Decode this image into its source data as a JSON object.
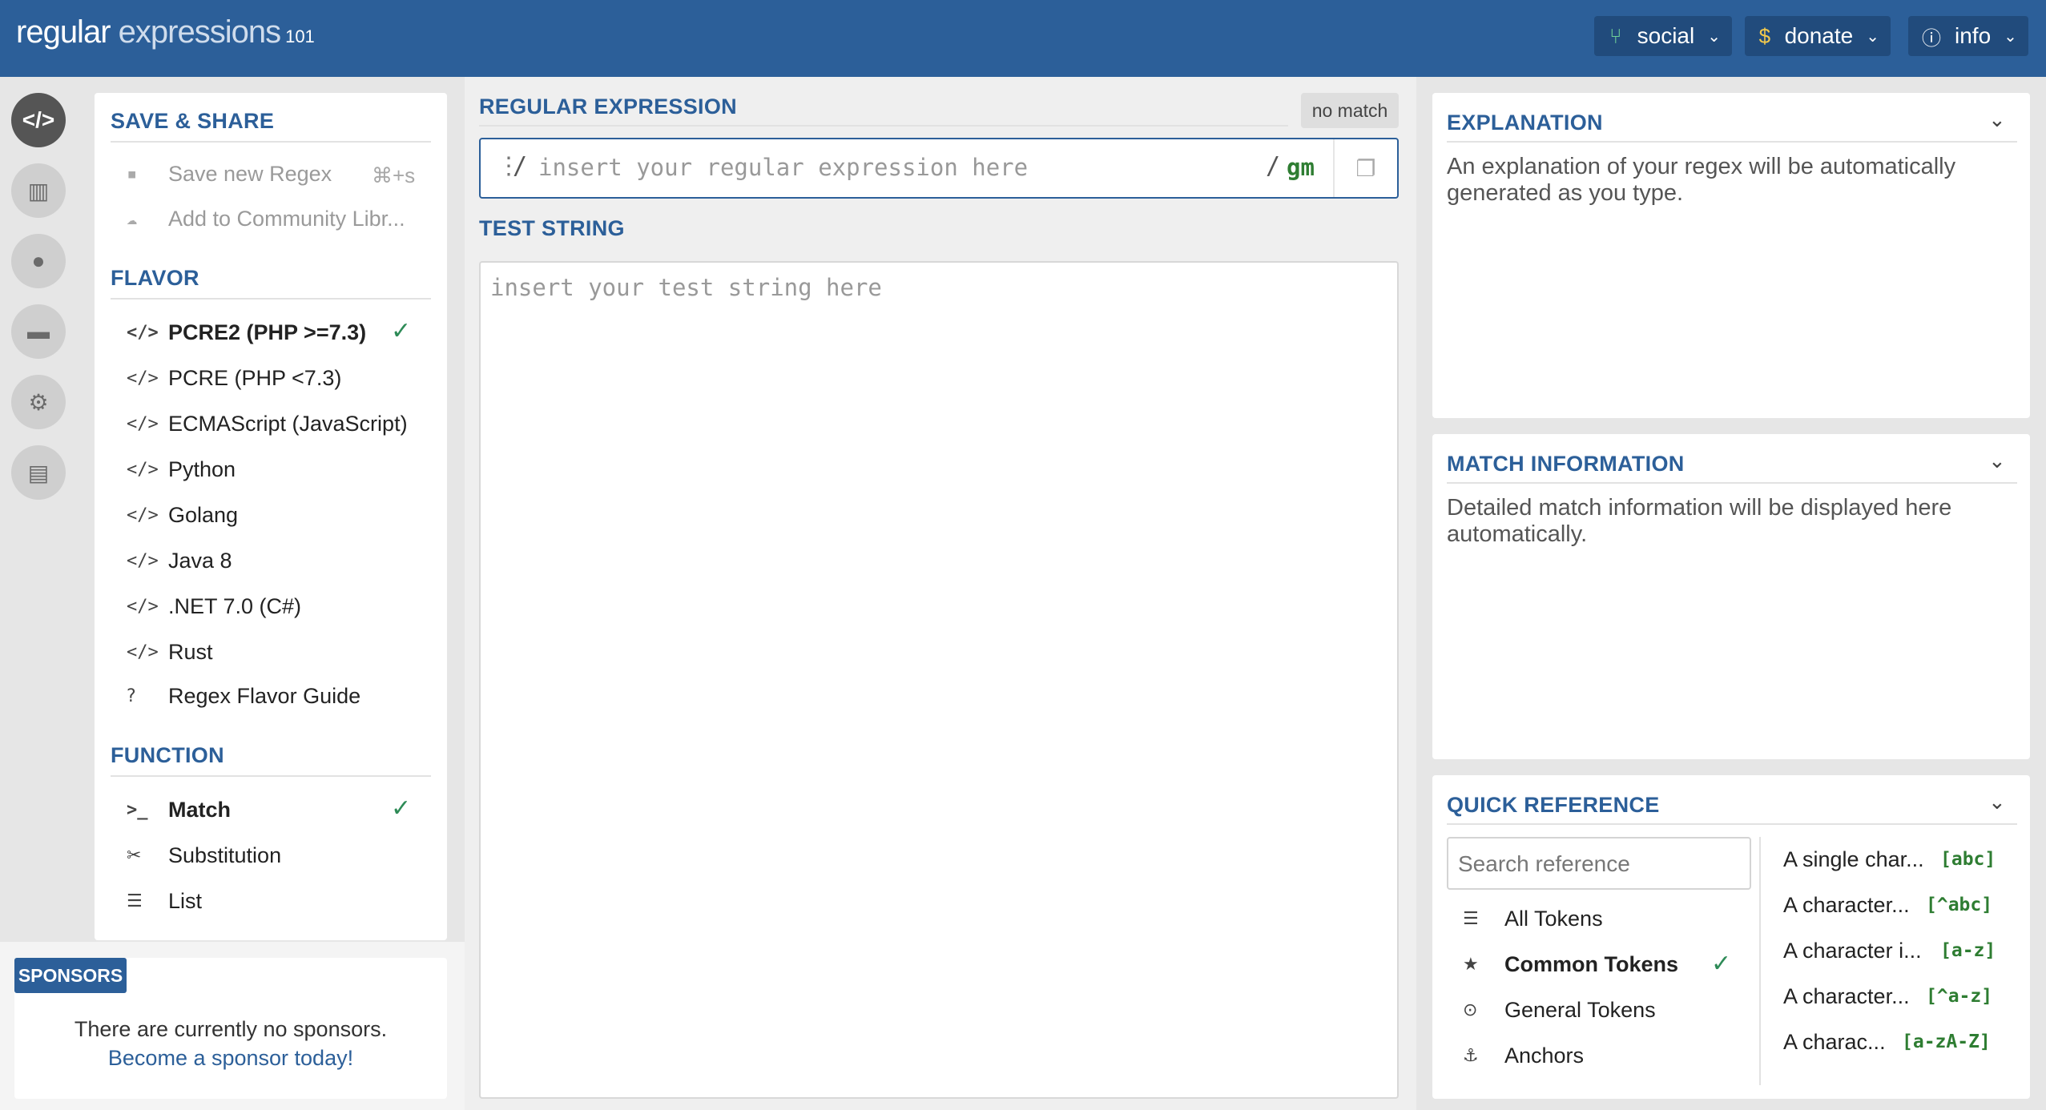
{
  "header": {
    "logo_main": "regular",
    "logo_light": " expressions",
    "logo_num": "101",
    "buttons": [
      {
        "label": "social",
        "icon": "branch-icon"
      },
      {
        "label": "donate",
        "icon": "dollar-icon"
      },
      {
        "label": "info",
        "icon": "info-icon"
      }
    ],
    "accent": "#2c5f99"
  },
  "left": {
    "save_share": {
      "title": "SAVE & SHARE",
      "items": [
        {
          "label": "Save new Regex",
          "shortcut": "⌘+s"
        },
        {
          "label": "Add to Community Libr..."
        }
      ]
    },
    "flavor": {
      "title": "FLAVOR",
      "items": [
        {
          "label": "PCRE2 (PHP >=7.3)",
          "selected": true
        },
        {
          "label": "PCRE (PHP <7.3)"
        },
        {
          "label": "ECMAScript (JavaScript)"
        },
        {
          "label": "Python"
        },
        {
          "label": "Golang"
        },
        {
          "label": "Java 8"
        },
        {
          "label": ".NET 7.0 (C#)"
        },
        {
          "label": "Rust"
        },
        {
          "label": "Regex Flavor Guide"
        }
      ]
    },
    "function": {
      "title": "FUNCTION",
      "items": [
        {
          "label": "Match",
          "selected": true
        },
        {
          "label": "Substitution"
        },
        {
          "label": "List"
        }
      ]
    },
    "sponsors": {
      "tag": "SPONSORS",
      "text": "There are currently no sponsors.",
      "link": "Become a sponsor today!"
    }
  },
  "center": {
    "regex_title": "REGULAR EXPRESSION",
    "status": "no match",
    "regex_open": "/",
    "regex_placeholder": "insert your regular expression here",
    "regex_close": "/",
    "flags": "gm",
    "test_title": "TEST STRING",
    "test_placeholder": "insert your test string here"
  },
  "right": {
    "explanation": {
      "title": "EXPLANATION",
      "text": "An explanation of your regex will be automatically generated as you type."
    },
    "match_info": {
      "title": "MATCH INFORMATION",
      "text": "Detailed match information will be displayed here automatically."
    },
    "quick_ref": {
      "title": "QUICK REFERENCE",
      "search_placeholder": "Search reference",
      "categories": [
        {
          "label": "All Tokens",
          "icon": "stack-icon"
        },
        {
          "label": "Common Tokens",
          "icon": "star-icon",
          "selected": true
        },
        {
          "label": "General Tokens",
          "icon": "target-icon"
        },
        {
          "label": "Anchors",
          "icon": "anchor-icon"
        }
      ],
      "tokens": [
        {
          "desc": "A single char...",
          "code": "[abc]"
        },
        {
          "desc": "A character...",
          "code": "[^abc]"
        },
        {
          "desc": "A character i...",
          "code": "[a-z]"
        },
        {
          "desc": "A character...",
          "code": "[^a-z]"
        },
        {
          "desc": "A charac...",
          "code": "[a-zA-Z]"
        }
      ]
    }
  }
}
